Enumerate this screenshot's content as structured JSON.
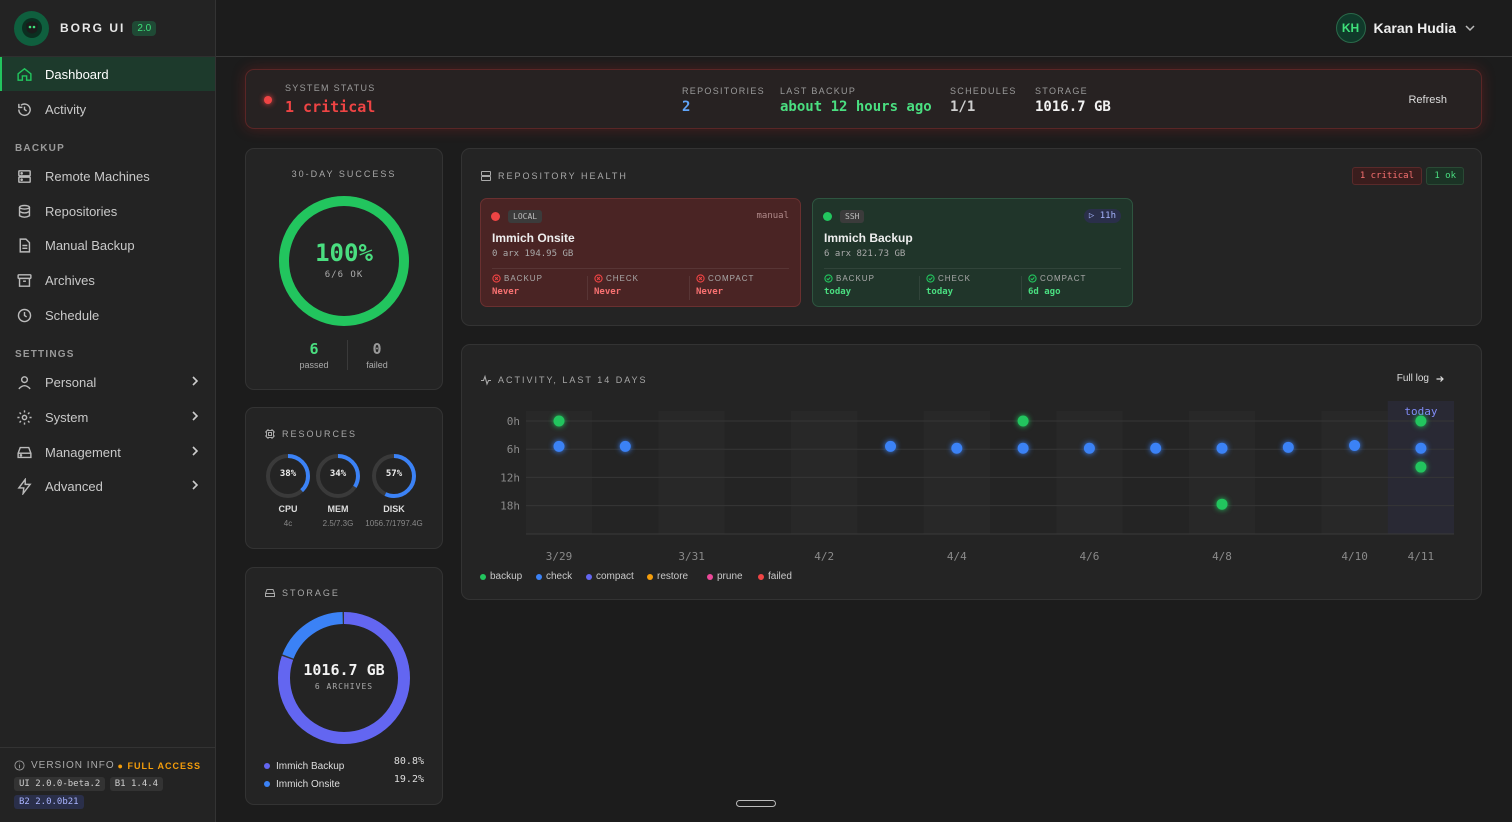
{
  "brand": {
    "name": "BORG UI",
    "version": "2.0"
  },
  "sidebar": {
    "top_items": [
      {
        "label": "Dashboard",
        "icon": "home-icon",
        "active": true
      },
      {
        "label": "Activity",
        "icon": "history-icon"
      }
    ],
    "backup_label": "BACKUP",
    "backup_items": [
      {
        "label": "Remote Machines",
        "icon": "server-icon"
      },
      {
        "label": "Repositories",
        "icon": "database-icon"
      },
      {
        "label": "Manual Backup",
        "icon": "file-icon"
      },
      {
        "label": "Archives",
        "icon": "archive-icon"
      },
      {
        "label": "Schedule",
        "icon": "clock-icon"
      }
    ],
    "settings_label": "SETTINGS",
    "settings_items": [
      {
        "label": "Personal",
        "icon": "user-icon"
      },
      {
        "label": "System",
        "icon": "gear-icon"
      },
      {
        "label": "Management",
        "icon": "drive-icon"
      },
      {
        "label": "Advanced",
        "icon": "bolt-icon"
      }
    ],
    "version_info": {
      "label": "VERSION INFO",
      "access": "FULL ACCESS",
      "ui": "UI 2.0.0-beta.2",
      "b1": "B1 1.4.4",
      "b2": "B2 2.0.0b21"
    }
  },
  "user": {
    "initials": "KH",
    "name": "Karan Hudia"
  },
  "status": {
    "label": "SYSTEM STATUS",
    "value": "1 critical",
    "repositories_label": "REPOSITORIES",
    "repositories": "2",
    "last_backup_label": "LAST BACKUP",
    "last_backup": "about 12 hours ago",
    "schedules_label": "SCHEDULES",
    "schedules": "1/1",
    "storage_label": "STORAGE",
    "storage": "1016.7 GB",
    "refresh": "Refresh"
  },
  "success": {
    "title": "30-DAY SUCCESS",
    "percent": "100%",
    "ratio": "6/6 OK",
    "rate": 1.0,
    "passed": "6",
    "passed_label": "passed",
    "failed": "0",
    "failed_label": "failed"
  },
  "resources": {
    "title": "RESOURCES",
    "items": [
      {
        "pct": "38%",
        "value": 0.38,
        "name": "CPU",
        "sub": "4c"
      },
      {
        "pct": "34%",
        "value": 0.34,
        "name": "MEM",
        "sub": "2.5/7.3G"
      },
      {
        "pct": "57%",
        "value": 0.57,
        "name": "DISK",
        "sub": "1056.7/1797.4G"
      }
    ]
  },
  "storage": {
    "title": "STORAGE",
    "total": "1016.7 GB",
    "archives": "6 ARCHIVES",
    "items": [
      {
        "name": "Immich Backup",
        "pct": "80.8%",
        "value": 0.808,
        "color": "#6366f1"
      },
      {
        "name": "Immich Onsite",
        "pct": "19.2%",
        "value": 0.192,
        "color": "#3b82f6"
      }
    ]
  },
  "health": {
    "title": "REPOSITORY HEALTH",
    "critical_badge": "1 critical",
    "ok_badge": "1 ok",
    "repos": [
      {
        "tag": "LOCAL",
        "mode": "manual",
        "name": "Immich Onsite",
        "sub": "0 arx  194.95 GB",
        "backup_label": "BACKUP",
        "backup": "Never",
        "check_label": "CHECK",
        "check": "Never",
        "compact_label": "COMPACT",
        "compact": "Never"
      },
      {
        "tag": "SSH",
        "mode": "▷ 11h",
        "name": "Immich Backup",
        "sub": "6 arx  821.73 GB",
        "backup_label": "BACKUP",
        "backup": "today",
        "check_label": "CHECK",
        "check": "today",
        "compact_label": "COMPACT",
        "compact": "6d ago"
      }
    ]
  },
  "activity": {
    "title": "ACTIVITY, LAST 14 DAYS",
    "full_log": "Full log",
    "legend": [
      {
        "name": "backup",
        "color": "#22c55e"
      },
      {
        "name": "check",
        "color": "#3b82f6"
      },
      {
        "name": "compact",
        "color": "#6366f1"
      },
      {
        "name": "restore",
        "color": "#f59e0b"
      },
      {
        "name": "prune",
        "color": "#ec4899"
      },
      {
        "name": "failed",
        "color": "#ef4444"
      }
    ]
  },
  "chart_data": {
    "type": "scatter",
    "x_labels": [
      "3/29",
      "3/31",
      "4/2",
      "4/4",
      "4/6",
      "4/8",
      "4/10",
      "4/11"
    ],
    "x_label_days": [
      0,
      2,
      4,
      6,
      8,
      10,
      12,
      13
    ],
    "y_ticks": [
      "0h",
      "6h",
      "12h",
      "18h"
    ],
    "y_tick_values": [
      0,
      6,
      12,
      18
    ],
    "ylim": [
      0,
      24
    ],
    "today_label": "today",
    "days": 14,
    "points": [
      {
        "day": 0,
        "hour": 0,
        "type": "backup"
      },
      {
        "day": 0,
        "hour": 5.4,
        "type": "check"
      },
      {
        "day": 1,
        "hour": 5.4,
        "type": "check"
      },
      {
        "day": 5,
        "hour": 5.4,
        "type": "check"
      },
      {
        "day": 6,
        "hour": 5.8,
        "type": "check"
      },
      {
        "day": 7,
        "hour": 0,
        "type": "backup"
      },
      {
        "day": 7,
        "hour": 5.8,
        "type": "check"
      },
      {
        "day": 8,
        "hour": 5.8,
        "type": "check"
      },
      {
        "day": 9,
        "hour": 5.8,
        "type": "check"
      },
      {
        "day": 10,
        "hour": 5.8,
        "type": "check"
      },
      {
        "day": 10,
        "hour": 17.7,
        "type": "backup"
      },
      {
        "day": 11,
        "hour": 5.6,
        "type": "check"
      },
      {
        "day": 12,
        "hour": 5.2,
        "type": "check"
      },
      {
        "day": 13,
        "hour": 0,
        "type": "backup"
      },
      {
        "day": 13,
        "hour": 5.8,
        "type": "check"
      },
      {
        "day": 13,
        "hour": 9.8,
        "type": "backup"
      }
    ]
  }
}
